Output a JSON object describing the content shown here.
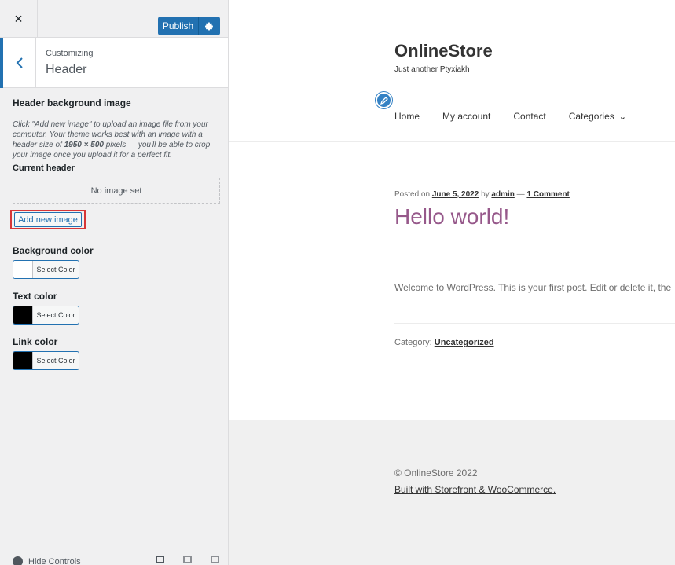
{
  "sidebar": {
    "close_icon": "×",
    "publish_label": "Publish",
    "gear_icon": "gear-icon",
    "customizing_label": "Customizing",
    "section_title": "Header",
    "header_image": {
      "title": "Header background image",
      "description_1": "Click \"Add new image\" to upload an image file from your computer. Your theme works best with an image with a header size of ",
      "description_size": "1950 × 500",
      "description_2": " pixels — you'll be able to crop your image once you upload it for a perfect fit.",
      "current_header_label": "Current header",
      "no_image_text": "No image set",
      "add_new_image_label": "Add new image"
    },
    "colors": [
      {
        "label": "Background color",
        "button": "Select Color",
        "swatch": "#ffffff"
      },
      {
        "label": "Text color",
        "button": "Select Color",
        "swatch": "#000000"
      },
      {
        "label": "Link color",
        "button": "Select Color",
        "swatch": "#000000"
      }
    ],
    "footer": {
      "hide_controls_label": "Hide Controls"
    }
  },
  "preview": {
    "site_title": "OnlineStore",
    "site_tagline": "Just another Ptyxiakh",
    "nav": {
      "home": "Home",
      "my_account": "My account",
      "contact": "Contact",
      "categories": "Categories"
    },
    "post": {
      "posted_on": "Posted on ",
      "date": "June 5, 2022",
      "by": " by ",
      "author": "admin",
      "dash": " — ",
      "comments": "1 Comment",
      "title": "Hello world!",
      "body": "Welcome to WordPress. This is your first post. Edit or delete it, the",
      "category_label": "Category: ",
      "category": "Uncategorized"
    },
    "footer": {
      "copyright": "© OnlineStore 2022",
      "built_with": "Built with Storefront & WooCommerce",
      "built_period": "."
    }
  },
  "colors": {
    "accent": "#2271b1",
    "highlight_border": "#d63638",
    "post_title": "#96588a"
  }
}
